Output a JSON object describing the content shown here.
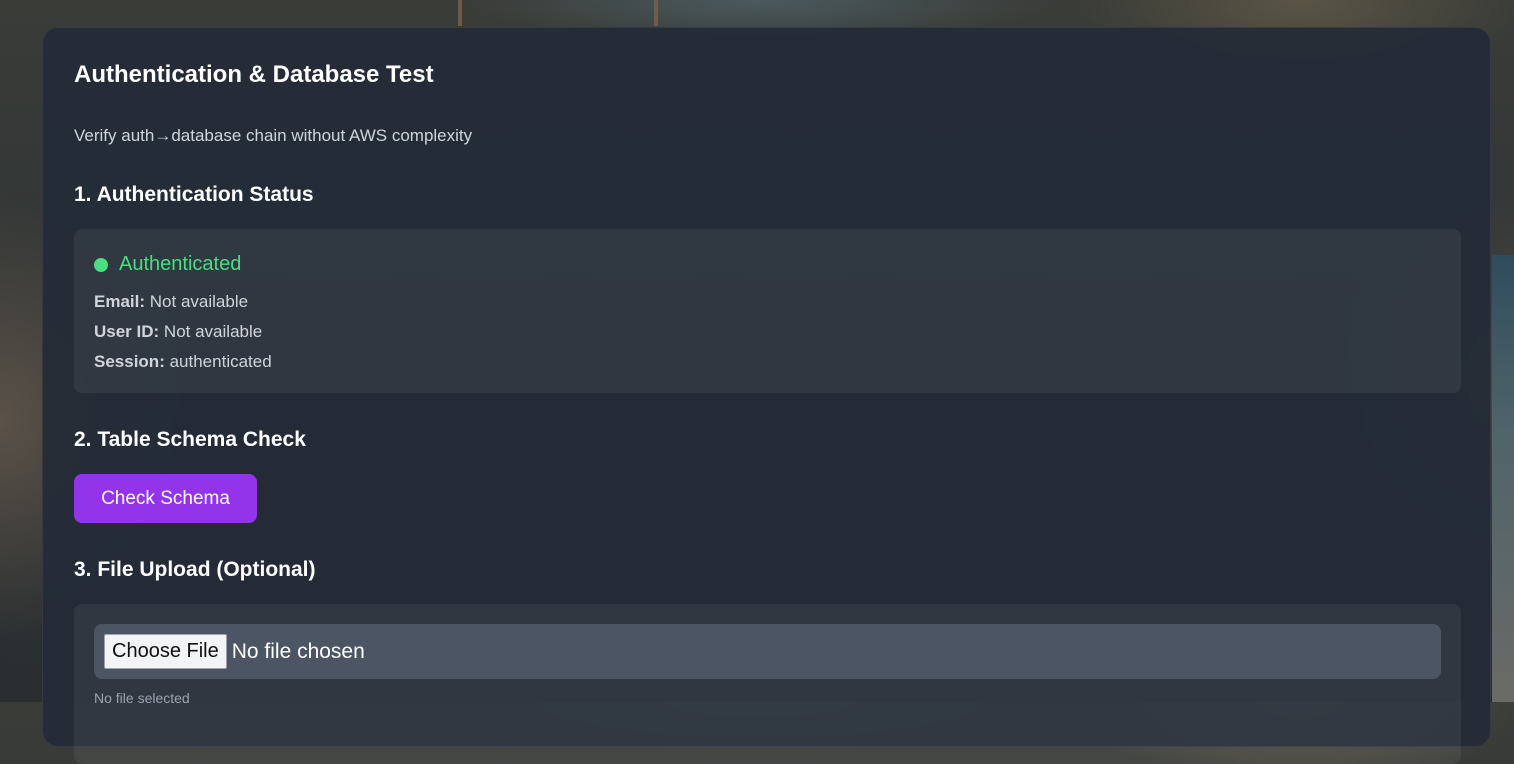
{
  "page": {
    "title": "Authentication & Database Test",
    "subtitle": "Verify auth→database chain without AWS complexity"
  },
  "auth": {
    "heading": "1. Authentication Status",
    "status": "Authenticated",
    "status_color": "#4ade80",
    "email_label": "Email:",
    "email_value": "Not available",
    "user_id_label": "User ID:",
    "user_id_value": "Not available",
    "session_label": "Session:",
    "session_value": "authenticated"
  },
  "schema": {
    "heading": "2. Table Schema Check",
    "button_label": "Check Schema",
    "button_color": "#9333ea"
  },
  "upload": {
    "heading": "3. File Upload (Optional)",
    "choose_label": "Choose File",
    "file_status": "No file chosen",
    "note": "No file selected"
  }
}
